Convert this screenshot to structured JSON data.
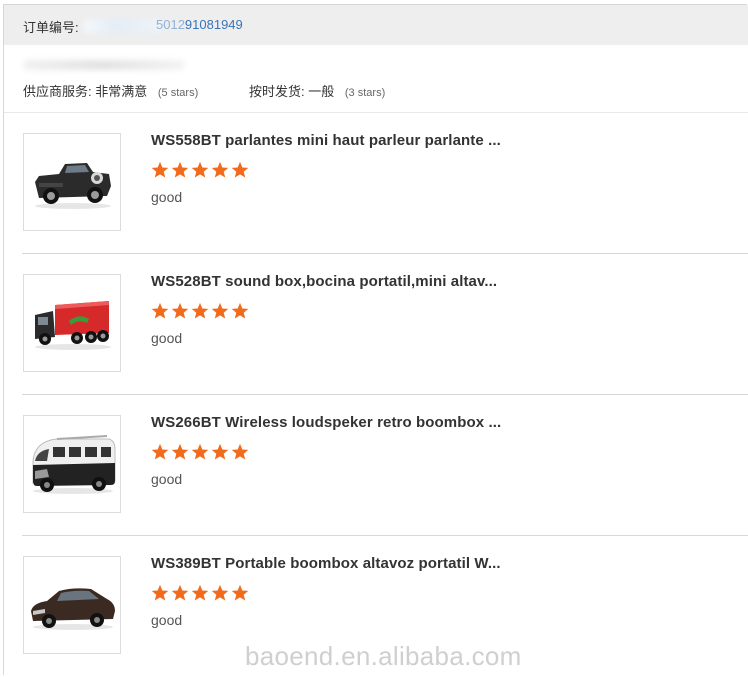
{
  "order": {
    "label": "订单编号:",
    "number_faded": "5012",
    "number_visible": "91081949"
  },
  "ratings": {
    "supplier_service_label": "供应商服务:",
    "supplier_service_value": "非常满意",
    "supplier_service_note": "(5 stars)",
    "on_time_label": "按时发货:",
    "on_time_value": "一般",
    "on_time_note": "(3 stars)"
  },
  "items": [
    {
      "title": "WS558BT parlantes mini haut parleur parlante ...",
      "stars": 5,
      "comment": "good",
      "thumb": "pickup-truck-speaker"
    },
    {
      "title": "WS528BT sound box,bocina portatil,mini altav...",
      "stars": 5,
      "comment": "good",
      "thumb": "container-truck-speaker"
    },
    {
      "title": "WS266BT Wireless loudspeker retro boombox ...",
      "stars": 5,
      "comment": "good",
      "thumb": "retro-bus-speaker"
    },
    {
      "title": "WS389BT Portable boombox altavoz portatil W...",
      "stars": 5,
      "comment": "good",
      "thumb": "suv-speaker"
    }
  ],
  "colors": {
    "star": "#f26a1b",
    "link": "#3a74b8",
    "header_bg": "#eeeeee"
  },
  "watermark": "baoend.en.alibaba.com"
}
